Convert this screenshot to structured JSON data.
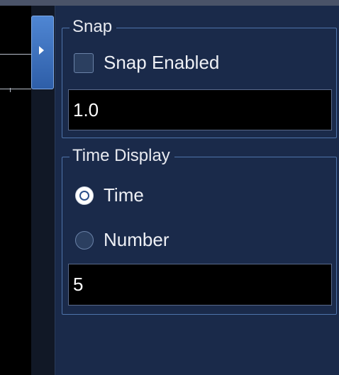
{
  "snap": {
    "title": "Snap",
    "enabled_label": "Snap Enabled",
    "enabled": false,
    "value": "1.0"
  },
  "time_display": {
    "title": "Time Display",
    "options": [
      "Time",
      "Number"
    ],
    "selected": "Time",
    "value": "5"
  },
  "colors": {
    "panel_background": "#1a2a4a",
    "group_border": "#4f74ab",
    "accent": "#4f86d3",
    "field_background": "#000000"
  },
  "icons": {
    "collapse_tab": "chevron-right-icon"
  }
}
